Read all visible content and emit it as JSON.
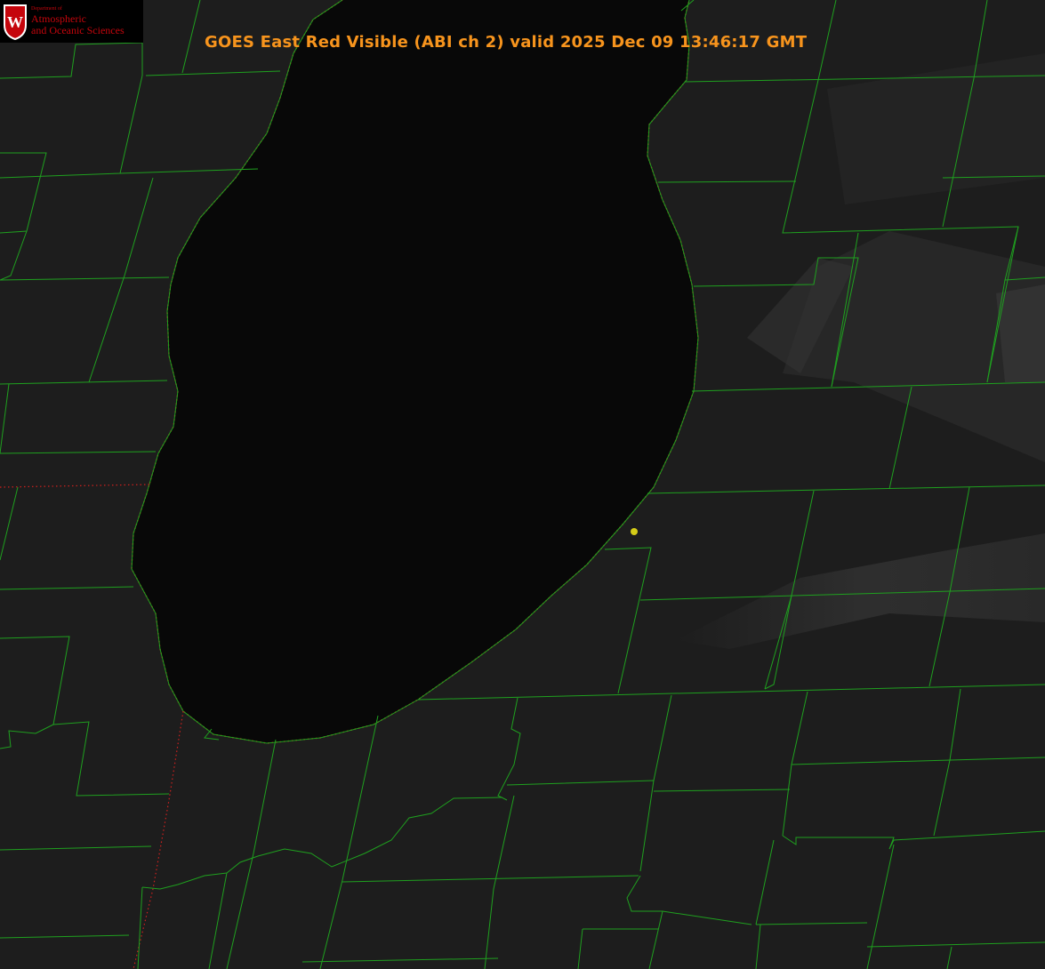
{
  "title": "GOES East Red Visible (ABI ch 2) valid 2025 Dec 09 13:46:17 GMT",
  "logo": {
    "department_label": "Department of",
    "line1": "Atmospheric",
    "line2": "and Oceanic Sciences",
    "crest_letter": "W"
  },
  "colors": {
    "title": "#f7941d",
    "county_lines": "#1fa01f",
    "shoreline_red_dotted": "#d0201e",
    "station_marker": "#d4cc18",
    "logo_red": "#c5050c",
    "lake": "#080808",
    "land": "#1e1e1e"
  },
  "icons": {
    "logo_crest": "uw-crest-icon",
    "station_marker": "station-dot-icon"
  }
}
